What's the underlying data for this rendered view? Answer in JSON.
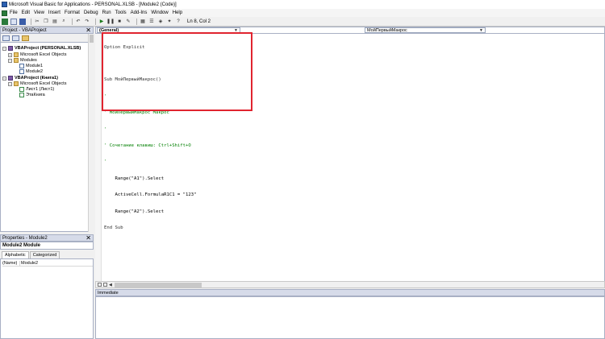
{
  "window": {
    "title": "Microsoft Visual Basic for Applications - PERSONAL.XLSB - [Module2 (Code)]"
  },
  "menu": [
    "File",
    "Edit",
    "View",
    "Insert",
    "Format",
    "Debug",
    "Run",
    "Tools",
    "Add-Ins",
    "Window",
    "Help"
  ],
  "toolbar": {
    "position": "Ln 8, Col 2"
  },
  "project": {
    "header": "Project - VBAProject",
    "tree": [
      {
        "label": "VBAProject (PERSONAL.XLSB)",
        "bold": true
      },
      {
        "label": "Microsoft Excel Objects"
      },
      {
        "label": "Modules"
      },
      {
        "label": "Module1"
      },
      {
        "label": "Module2"
      },
      {
        "label": "VBAProject (Книга1)",
        "bold": true
      },
      {
        "label": "Microsoft Excel Objects"
      },
      {
        "label": "Лист1 (Лист1)"
      },
      {
        "label": "ЭтаКнига"
      }
    ]
  },
  "properties": {
    "header": "Properties - Module2",
    "object": "Module2 Module",
    "tabs": [
      "Alphabetic",
      "Categorized"
    ],
    "rows": [
      {
        "name": "(Name)",
        "value": "Module2"
      }
    ]
  },
  "code": {
    "object_combo": "(General)",
    "proc_combo": "МойПервыйМакрос",
    "lines": [
      "Option Explicit",
      "",
      "Sub МойПервыйМакрос()",
      "'",
      "' МойПервыйМакрос Макрос",
      "'",
      "' Сочетание клавиш: Ctrl+Shift+O",
      "'",
      "    Range(\"A1\").Select",
      "    ActiveCell.FormulaR1C1 = \"123\"",
      "    Range(\"A2\").Select",
      "End Sub"
    ]
  },
  "immediate": {
    "header": "Immediate"
  },
  "colors": {
    "highlight": "#e0242f",
    "comment": "#007f00",
    "panel_header": "#d6dbe9"
  }
}
